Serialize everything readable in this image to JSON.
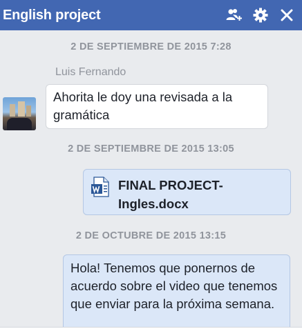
{
  "window": {
    "title": "English project",
    "icons": [
      "add-people-icon",
      "gear-icon",
      "close-icon"
    ]
  },
  "messages": {
    "timestamp1": "2 DE SEPTIEMBRE DE 2015 7:28",
    "sender1": "Luis Fernando",
    "text1": "Ahorita le doy una revisada a la gramática",
    "timestamp2": "2 DE SEPTIEMBRE DE 2015 13:05",
    "file_name": "FINAL PROJECT-Ingles.docx",
    "file_icon": "word-document-icon",
    "timestamp3": "2 DE OCTUBRE DE 2015 13:15",
    "text2": "Hola! Tenemos que ponernos de acuerdo sobre el video que tenemos que enviar para la próxima semana."
  },
  "colors": {
    "header": "#4267b2",
    "background": "#e9ebee",
    "outgoing_bubble": "#dbe7f8",
    "timestamp_text": "#90949c"
  }
}
